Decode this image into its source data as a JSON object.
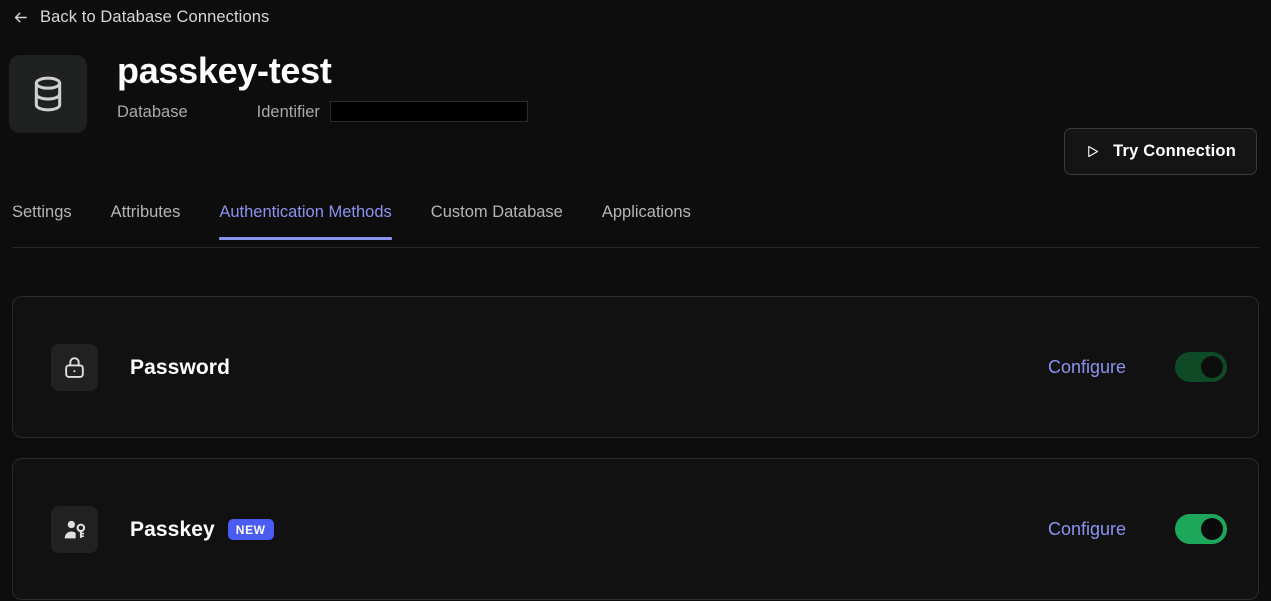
{
  "back_link": {
    "label": "Back to Database Connections",
    "icon": "arrow-left-icon"
  },
  "header": {
    "icon": "database-icon",
    "title": "passkey-test",
    "kind_label": "Database",
    "identifier_label": "Identifier",
    "identifier_value": "",
    "identifier_redacted": true
  },
  "actions": {
    "try_connection_label": "Try Connection",
    "try_connection_icon": "play-triangle-icon"
  },
  "tabs": [
    {
      "label": "Settings",
      "active": false
    },
    {
      "label": "Attributes",
      "active": false
    },
    {
      "label": "Authentication Methods",
      "active": true
    },
    {
      "label": "Custom Database",
      "active": false
    },
    {
      "label": "Applications",
      "active": false
    }
  ],
  "authentication_methods": [
    {
      "name": "Password",
      "icon": "lock-icon",
      "badge": "",
      "configure_label": "Configure",
      "enabled": true,
      "toggle_state": "on"
    },
    {
      "name": "Passkey",
      "icon": "passkey-person-key-icon",
      "badge": "NEW",
      "configure_label": "Configure",
      "enabled": true,
      "toggle_state": "on"
    }
  ],
  "colors": {
    "background": "#0d0d0d",
    "card_background": "#111111",
    "card_border": "#2b2b2b",
    "accent_link": "#8b93ef",
    "badge_new": "#4a5cf2",
    "toggle_on": "#0f4a26",
    "toggle_on_bright": "#1da75a",
    "text_primary": "#ffffff",
    "text_muted": "#a9a9a9"
  }
}
